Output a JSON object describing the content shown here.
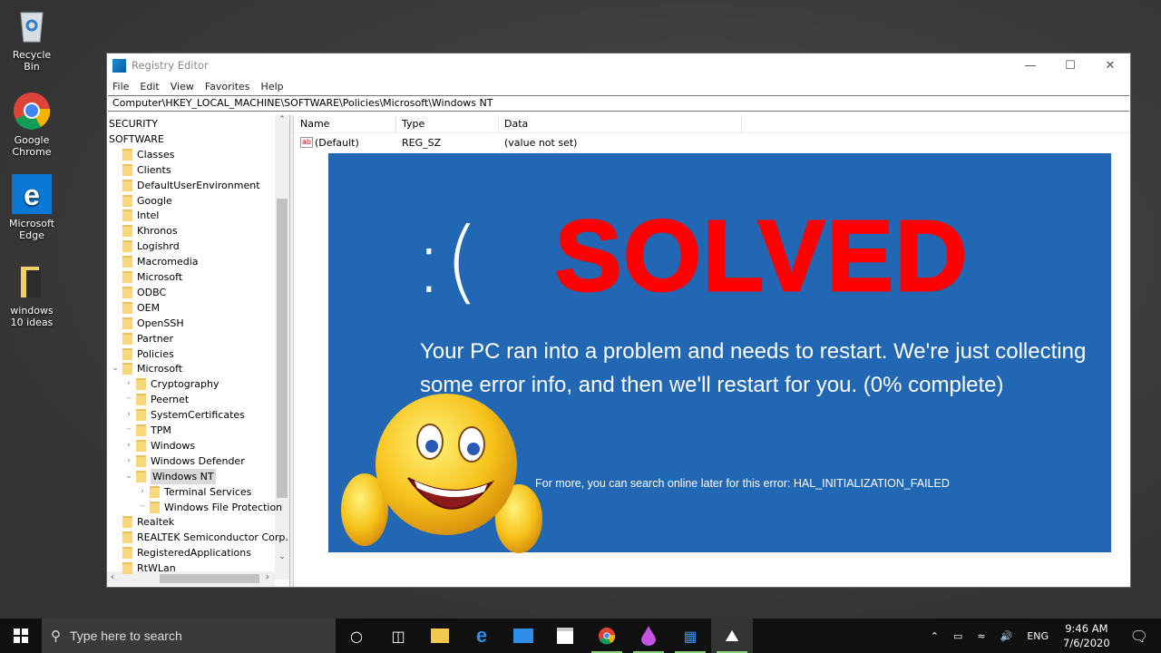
{
  "desktop": {
    "icons": [
      {
        "label": "Recycle Bin",
        "icon": "recycle-bin-icon"
      },
      {
        "label": "Google Chrome",
        "icon": "chrome-icon"
      },
      {
        "label": "Microsoft Edge",
        "icon": "edge-icon"
      },
      {
        "label": "windows 10 ideas",
        "icon": "folder-icon"
      }
    ]
  },
  "window": {
    "title": "Registry Editor",
    "menu": [
      "File",
      "Edit",
      "View",
      "Favorites",
      "Help"
    ],
    "address": "Computer\\HKEY_LOCAL_MACHINE\\SOFTWARE\\Policies\\Microsoft\\Windows NT",
    "tree": [
      {
        "label": "SECURITY",
        "level": 0,
        "folder": false
      },
      {
        "label": "SOFTWARE",
        "level": 0,
        "folder": false
      },
      {
        "label": "Classes",
        "level": 1
      },
      {
        "label": "Clients",
        "level": 1
      },
      {
        "label": "DefaultUserEnvironment",
        "level": 1
      },
      {
        "label": "Google",
        "level": 1
      },
      {
        "label": "Intel",
        "level": 1
      },
      {
        "label": "Khronos",
        "level": 1
      },
      {
        "label": "Logishrd",
        "level": 1
      },
      {
        "label": "Macromedia",
        "level": 1
      },
      {
        "label": "Microsoft",
        "level": 1
      },
      {
        "label": "ODBC",
        "level": 1
      },
      {
        "label": "OEM",
        "level": 1
      },
      {
        "label": "OpenSSH",
        "level": 1
      },
      {
        "label": "Partner",
        "level": 1
      },
      {
        "label": "Policies",
        "level": 1
      },
      {
        "label": "Microsoft",
        "level": 2,
        "expander": "expanded"
      },
      {
        "label": "Cryptography",
        "level": 3,
        "expander": "collapsed"
      },
      {
        "label": "Peernet",
        "level": 3,
        "expander": "none"
      },
      {
        "label": "SystemCertificates",
        "level": 3,
        "expander": "collapsed"
      },
      {
        "label": "TPM",
        "level": 3,
        "expander": "none"
      },
      {
        "label": "Windows",
        "level": 3,
        "expander": "collapsed"
      },
      {
        "label": "Windows Defender",
        "level": 3,
        "expander": "collapsed"
      },
      {
        "label": "Windows NT",
        "level": 3,
        "expander": "expanded",
        "selected": true
      },
      {
        "label": "Terminal Services",
        "level": 4,
        "expander": "collapsed"
      },
      {
        "label": "Windows File Protection",
        "level": 4,
        "expander": "none"
      },
      {
        "label": "Realtek",
        "level": 1
      },
      {
        "label": "REALTEK Semiconductor Corp.",
        "level": 1
      },
      {
        "label": "RegisteredApplications",
        "level": 1
      },
      {
        "label": "RtWLan",
        "level": 1
      }
    ],
    "columns": [
      "Name",
      "Type",
      "Data"
    ],
    "values": [
      {
        "name": "(Default)",
        "type": "REG_SZ",
        "data": "(value not set)"
      }
    ]
  },
  "overlay": {
    "sad_face": ":(",
    "headline": "SOLVED",
    "message": "Your PC ran into a problem and needs to restart. We're just collecting some error info, and then we'll restart for you. (0% complete)",
    "error_line": "For more, you can search online later for this error: HAL_INITIALIZATION_FAILED",
    "bg_color": "#2167b3",
    "headline_color": "#ff0000"
  },
  "taskbar": {
    "search_placeholder": "Type here to search",
    "apps": [
      "cortana",
      "task-view",
      "file-explorer",
      "edge",
      "mail",
      "store",
      "chrome",
      "paint-3d",
      "app",
      "photos"
    ],
    "language": "ENG",
    "time": "9:46 AM",
    "date": "7/6/2020"
  }
}
